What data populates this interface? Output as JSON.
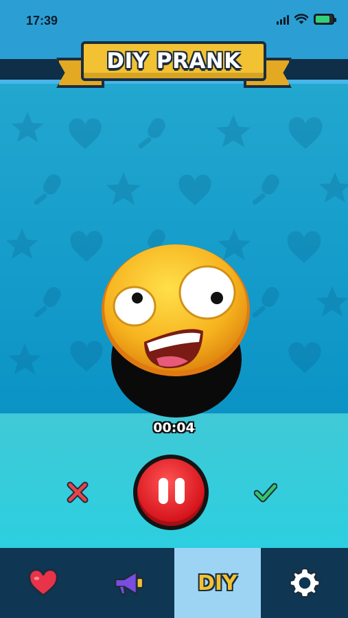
{
  "status_bar": {
    "time": "17:39",
    "icons": [
      "signal-icon",
      "wifi-icon",
      "battery-charging-icon"
    ]
  },
  "header": {
    "title": "DIY PRANK"
  },
  "recorder": {
    "timer": "00:04",
    "cancel_icon": "cross-icon",
    "record_icon": "pause-icon",
    "confirm_icon": "checkmark-icon"
  },
  "nav": {
    "items": [
      {
        "icon": "heart-icon",
        "label": ""
      },
      {
        "icon": "megaphone-icon",
        "label": ""
      },
      {
        "icon": "diy-icon",
        "label": "DIY"
      },
      {
        "icon": "settings-gear-icon",
        "label": ""
      }
    ],
    "active_index": 2
  },
  "colors": {
    "background_top": "#2b9fd3",
    "pattern": "#0b93c6",
    "lower": "#2ccfe0",
    "nav": "#0f3653",
    "nav_active": "#9dd4f4",
    "banner": "#f2c233",
    "record": "#d4121a"
  }
}
